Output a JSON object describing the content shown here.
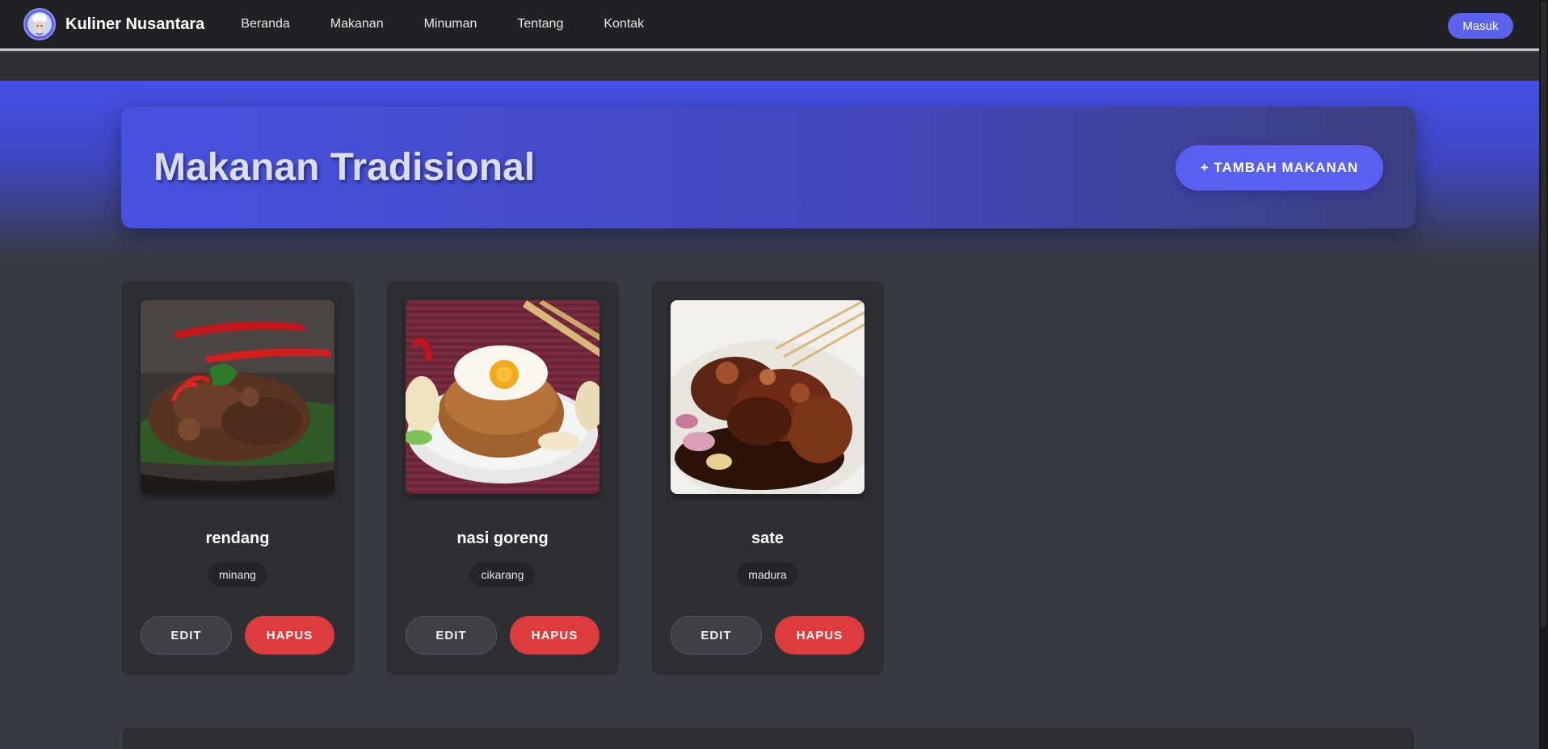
{
  "navbar": {
    "brand": "Kuliner Nusantara",
    "links": [
      "Beranda",
      "Makanan",
      "Minuman",
      "Tentang",
      "Kontak"
    ],
    "login": "Masuk"
  },
  "hero": {
    "title": "Makanan Tradisional",
    "add_button": "+ TAMBAH MAKANAN"
  },
  "foods": [
    {
      "name": "rendang",
      "origin": "minang",
      "edit": "EDIT",
      "delete": "HAPUS"
    },
    {
      "name": "nasi goreng",
      "origin": "cikarang",
      "edit": "EDIT",
      "delete": "HAPUS"
    },
    {
      "name": "sate",
      "origin": "madura",
      "edit": "EDIT",
      "delete": "HAPUS"
    }
  ],
  "colors": {
    "accent": "#5b62ee",
    "danger": "#dc3c3e",
    "navbar": "#202124",
    "background": "#383a42"
  }
}
